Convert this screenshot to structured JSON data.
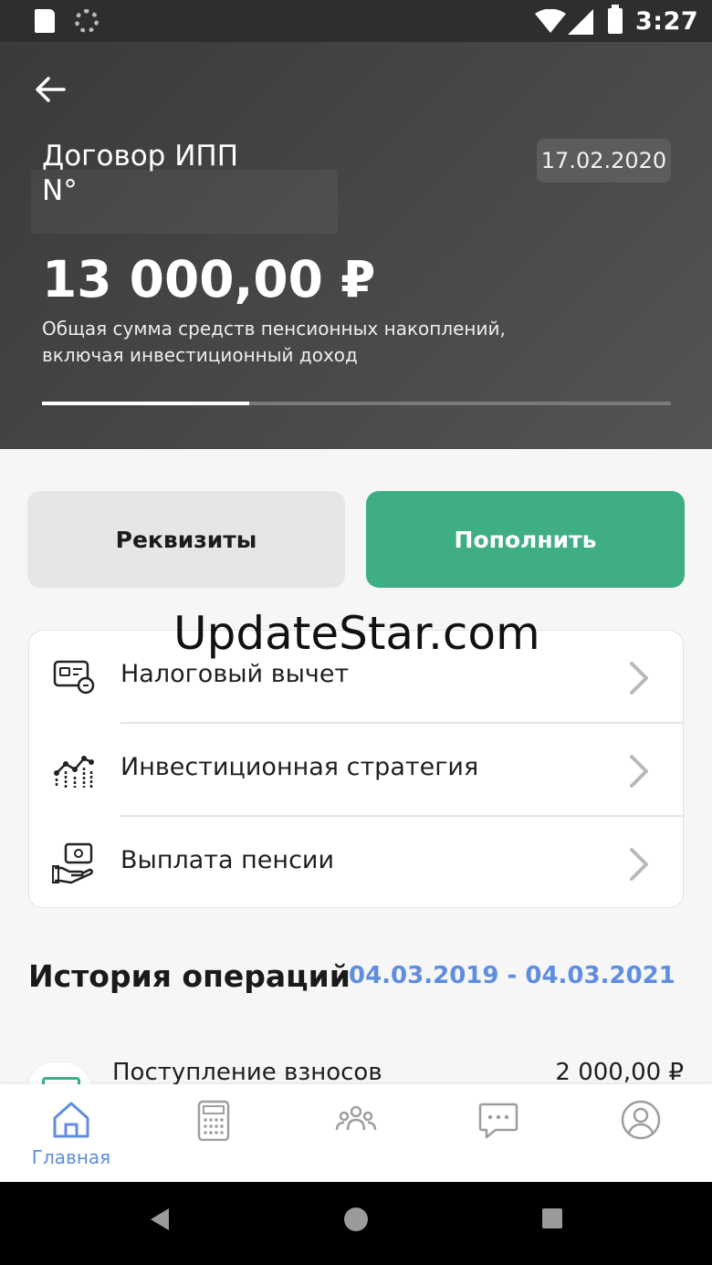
{
  "status_bar": {
    "time": "3:27"
  },
  "header": {
    "title": "Договор ИПП",
    "number_label": "N°",
    "date": "17.02.2020",
    "amount": "13 000,00 ₽",
    "description": "Общая сумма средств пенсионных накоплений, включая инвестиционный доход",
    "progress_fraction": 0.33
  },
  "actions": {
    "details_label": "Реквизиты",
    "topup_label": "Пополнить",
    "topup_color": "#3fae84"
  },
  "menu": {
    "items": [
      {
        "label": "Налоговый вычет",
        "icon": "tax-deduction-icon"
      },
      {
        "label": "Инвестиционная стратегия",
        "icon": "investment-strategy-icon"
      },
      {
        "label": "Выплата пенсии",
        "icon": "pension-payment-icon"
      }
    ]
  },
  "watermark": "UpdateStar.com",
  "history": {
    "title": "История операций",
    "period": "04.03.2019 - 04.03.2021",
    "period_color": "#5f8de0",
    "rows": [
      {
        "label": "Поступление взносов",
        "amount": "2 000,00 ₽"
      }
    ]
  },
  "bottom_nav": {
    "items": [
      {
        "label": "Главная",
        "icon": "home-icon",
        "active": true
      },
      {
        "label": "",
        "icon": "calculator-icon",
        "active": false
      },
      {
        "label": "",
        "icon": "people-icon",
        "active": false
      },
      {
        "label": "",
        "icon": "chat-icon",
        "active": false
      },
      {
        "label": "",
        "icon": "profile-icon",
        "active": false
      }
    ],
    "active_color": "#5f8de0",
    "inactive_color": "#9e9e9e"
  }
}
